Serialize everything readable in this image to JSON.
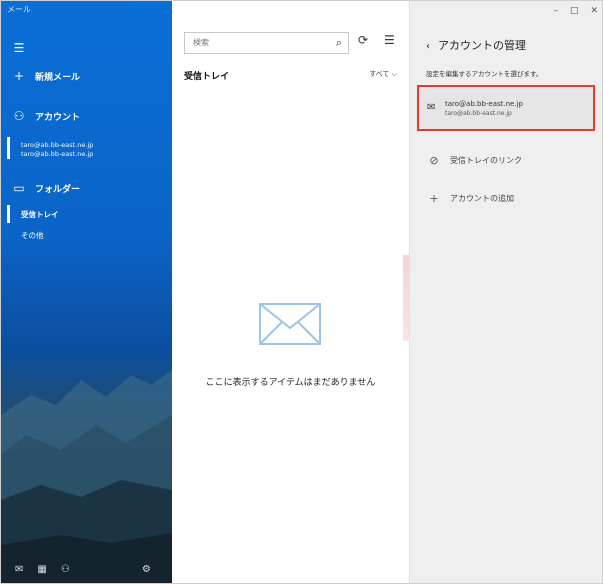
{
  "nav": {
    "app_title": "メール",
    "menu_icon": "hamburger-icon",
    "new_mail": {
      "icon": "plus-icon",
      "label": "新規メール"
    },
    "accounts": {
      "icon": "person-icon",
      "label": "アカウント"
    },
    "account": {
      "email": "taro@ab.bb-east.ne.jp",
      "sub": "taro@ab.bb-east.ne.jp"
    },
    "folders": {
      "icon": "folder-icon",
      "label": "フォルダー"
    },
    "folder_items": [
      "受信トレイ",
      "その他"
    ],
    "bottom_icons": [
      "mail-icon",
      "calendar-icon",
      "people-icon",
      "settings-icon"
    ]
  },
  "list": {
    "search_placeholder": "検索",
    "inbox_title": "受信トレイ",
    "filter_label": "すべて ⌵",
    "empty_text": "ここに表示するアイテムはまだありません"
  },
  "manager": {
    "window_buttons": {
      "minimize": "–",
      "maximize": "□",
      "close": "✕"
    },
    "title": "アカウントの管理",
    "hint": "設定を編集するアカウントを選びます。",
    "card": {
      "email": "taro@ab.bb-east.ne.jp",
      "sub": "taro@ab.bb-east.ne.jp"
    },
    "actions": [
      {
        "icon": "link-icon",
        "label": "受信トレイのリンク"
      },
      {
        "icon": "plus-icon",
        "label": "アカウントの追加"
      }
    ]
  },
  "colors": {
    "accent": "#0a6ed8",
    "highlight": "#e53a2f"
  }
}
